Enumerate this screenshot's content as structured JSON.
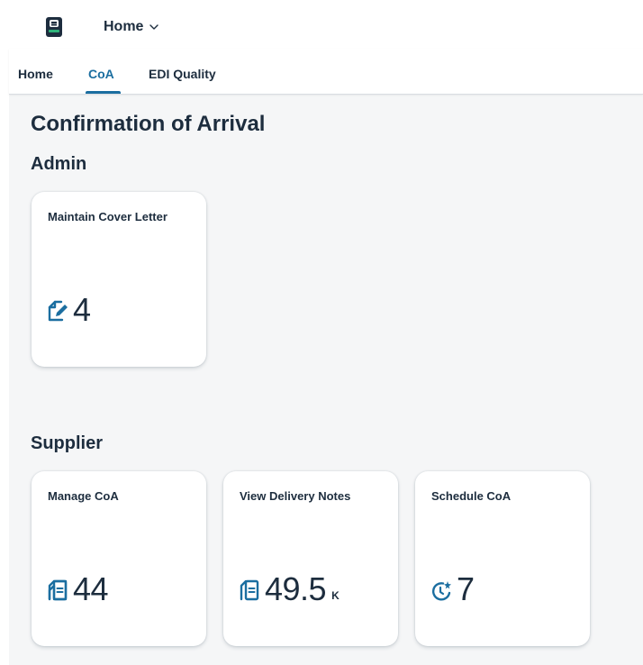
{
  "shell": {
    "app_title": "Home"
  },
  "tabs": [
    {
      "label": "Home",
      "selected": false
    },
    {
      "label": "CoA",
      "selected": true
    },
    {
      "label": "EDI Quality",
      "selected": false
    }
  ],
  "page": {
    "title": "Confirmation of Arrival"
  },
  "sections": [
    {
      "title": "Admin",
      "tiles": [
        {
          "title": "Maintain Cover Letter",
          "value": "4",
          "scale": "",
          "icon": "document-edit-icon"
        }
      ]
    },
    {
      "title": "Supplier",
      "tiles": [
        {
          "title": "Manage CoA",
          "value": "44",
          "scale": "",
          "icon": "documents-icon"
        },
        {
          "title": "View Delivery Notes",
          "value": "49.5",
          "scale": "K",
          "icon": "documents-icon"
        },
        {
          "title": "Schedule CoA",
          "value": "7",
          "scale": "",
          "icon": "scheduled-night-icon"
        }
      ]
    }
  ],
  "colors": {
    "text": "#1d2d3e",
    "icon": "#1b6ea0",
    "background": "#f5f6f7",
    "tile": "#ffffff",
    "selected_tab": "#1b6ea0"
  }
}
